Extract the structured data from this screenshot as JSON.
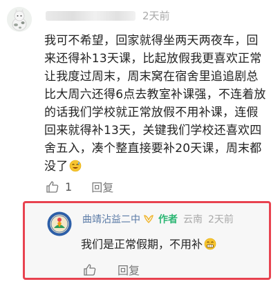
{
  "comment": {
    "user_name": "",
    "time": "2天前",
    "text": "我可不希望，回家就得坐两天两夜车，回来还得补13天课，比起放假我更喜欢正常让我度过周末，周末窝在宿舍里追追剧总比大周六还得6点去教室补课强，不连着放的话我们学校就正常放假不用补课，连假回来就得补13天，关键我们学校还喜欢四舍五入，凑个整直接要补20天课，周末都没了",
    "emoji": "sweat-smile-emoji",
    "like_count": "1",
    "reply_label": "回复"
  },
  "reply": {
    "user_name": "曲靖沾益二中",
    "verified_icon": "ribbon-badge-icon",
    "author_badge": "作者",
    "location": "云南",
    "time": "2天前",
    "text": "我们是正常假期，不用补",
    "emoji": "grin-emoji",
    "reply_label": "回复"
  },
  "colors": {
    "highlight_border": "#e8424f",
    "author_badge": "#2bb673",
    "reply_name": "#5a7aa6",
    "meta_gray": "#a9a9a9"
  }
}
